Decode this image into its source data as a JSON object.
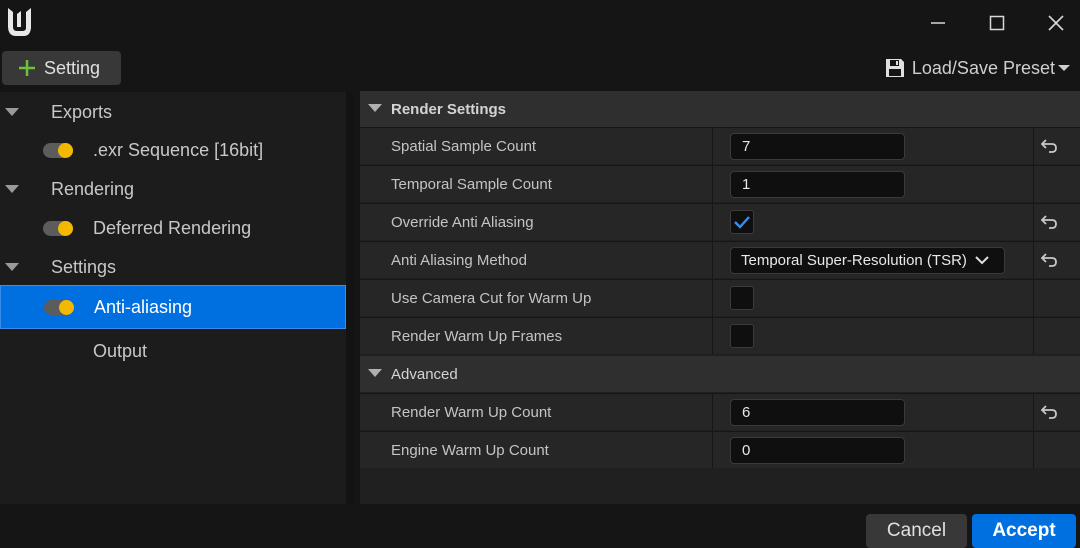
{
  "toolbar": {
    "add_setting_label": "Setting",
    "preset_label": "Load/Save Preset"
  },
  "tree": [
    {
      "type": "category",
      "label": "Exports"
    },
    {
      "type": "item",
      "label": ".exr Sequence [16bit]",
      "enabled": true
    },
    {
      "type": "category",
      "label": "Rendering"
    },
    {
      "type": "item",
      "label": "Deferred Rendering",
      "enabled": true
    },
    {
      "type": "category",
      "label": "Settings"
    },
    {
      "type": "item",
      "label": "Anti-aliasing",
      "enabled": true,
      "selected": true
    },
    {
      "type": "item",
      "label": "Output",
      "enabled": false
    }
  ],
  "details": {
    "render_settings": {
      "title": "Render Settings",
      "spatial_sample_count": {
        "label": "Spatial Sample Count",
        "value": "7"
      },
      "temporal_sample_count": {
        "label": "Temporal Sample Count",
        "value": "1"
      },
      "override_anti_aliasing": {
        "label": "Override Anti Aliasing",
        "checked": true
      },
      "anti_aliasing_method": {
        "label": "Anti Aliasing Method",
        "value": "Temporal Super-Resolution (TSR)"
      },
      "use_camera_cut": {
        "label": "Use Camera Cut for Warm Up",
        "checked": false
      },
      "render_warm_up_frames": {
        "label": "Render Warm Up Frames",
        "checked": false
      }
    },
    "advanced": {
      "title": "Advanced",
      "render_warm_up_count": {
        "label": "Render Warm Up Count",
        "value": "6"
      },
      "engine_warm_up_count": {
        "label": "Engine Warm Up Count",
        "value": "0"
      }
    }
  },
  "footer": {
    "cancel_label": "Cancel",
    "accept_label": "Accept"
  },
  "colors": {
    "accent": "#0070e0",
    "toggle_on": "#f5b800",
    "check": "#3a8de8"
  }
}
